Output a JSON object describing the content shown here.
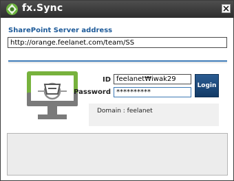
{
  "window": {
    "title": "fx.Sync",
    "close_symbol": "×",
    "logo_icon": "fx-sync-logo-icon",
    "close_icon": "close-icon"
  },
  "server": {
    "label": "SharePoint Server address",
    "value": "http://orange.feelanet.com/team/SS"
  },
  "login": {
    "id_label": "ID",
    "id_value": "feelanet₩iwak29",
    "password_label": "Password",
    "password_value": "**********",
    "button_label": "Login"
  },
  "domain": {
    "text": "Domain : feelanet"
  },
  "colors": {
    "accent_blue": "#1d5a99",
    "button_blue": "#123a66",
    "green": "#77b23d"
  }
}
